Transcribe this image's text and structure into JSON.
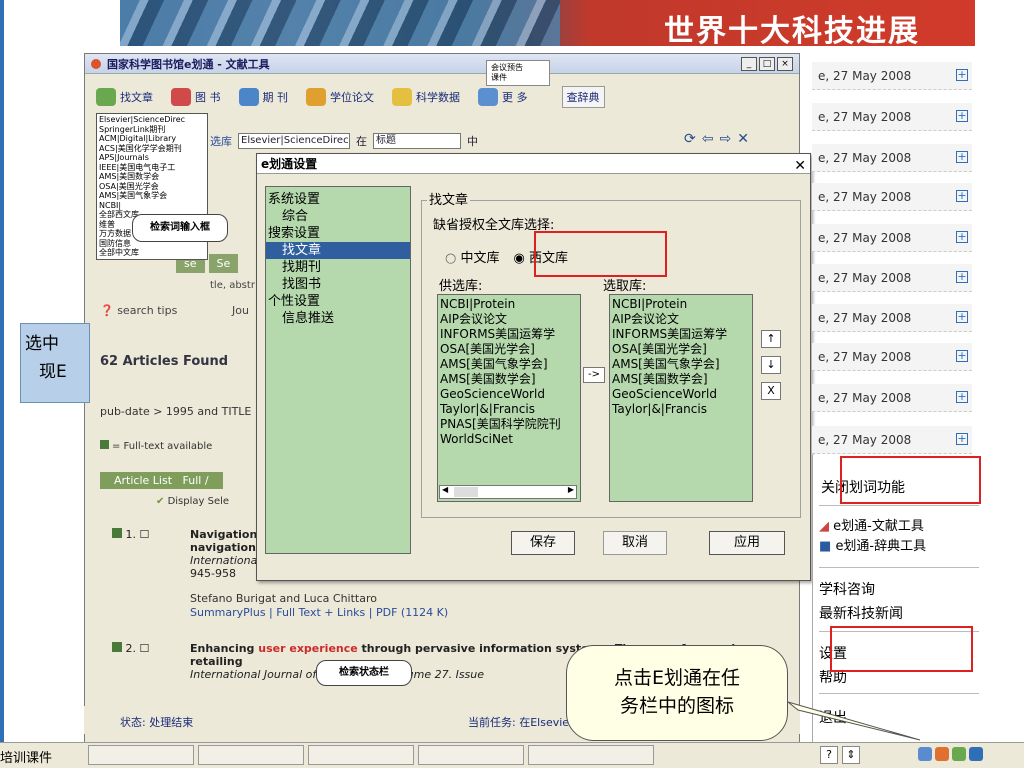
{
  "banner": {
    "title": "世界十大科技进展"
  },
  "main_window": {
    "title": "国家科学图书馆e划通 - 文献工具",
    "toolbar": [
      "找文章",
      "图 书",
      "期 刊",
      "学位论文",
      "科学数据",
      "更 多",
      "查辞典"
    ],
    "search_label": "选库",
    "db_select": "Elsevier|ScienceDirec",
    "in_label": "在",
    "field_select": "标题",
    "mid_label": "中",
    "more_popup": [
      "会议预告",
      "课件"
    ],
    "db_list": [
      "Elsevier|ScienceDirec",
      "SpringerLink期刊",
      "ACM|Digital|Library",
      "ACS|美国化学学会期刊",
      "APS|Journals",
      "IEEE|美国电气电子工",
      "AMS|美国数学会",
      "OSA|美国光学会",
      "AMS|美国气象学会",
      "NCBI|",
      "全部西文库",
      "维普",
      "万方数据",
      "国防信息",
      "全部中文库"
    ],
    "callout_search": "检索词输入框",
    "web": {
      "tabs": [
        "se",
        "Se"
      ],
      "abstr": "tle, abstr",
      "search_tips": "search tips",
      "jou": "Jou",
      "found": "62 Articles Found",
      "pubdate": "pub-date > 1995 and TITLE",
      "fulltext": "= Full-text available",
      "article_list": "Article List",
      "full": "Full /",
      "display_sel": "Display Sele",
      "art1_num": "1.",
      "art1_lines": [
        "Navigation",
        "navigation a",
        "Internationa",
        "945-958"
      ],
      "authors": "Stefano Burigat and Luca Chittaro",
      "links": "SummaryPlus | Full Text + Links | PDF (1124 K)",
      "art2_num": "2.",
      "art2_text_a": "Enhancing ",
      "art2_red": "user experience",
      "art2_text_b": " through pervasive information systems: The case of pervasive",
      "art2_line2": "retailing",
      "art2_line3": "International Journal of ... agement. Volume 27. Issue"
    },
    "status_left": "状态:  处理结束",
    "status_right": "当前任务:  在Elsevie",
    "callout_status": "检索状态栏"
  },
  "left_note": {
    "line1": "选中",
    "line2": "现E"
  },
  "dialog": {
    "title": "e划通设置",
    "tree": [
      "系统设置",
      "综合",
      "搜索设置",
      "找文章",
      "找期刊",
      "找图书",
      "个性设置",
      "信息推送"
    ],
    "group_title": "找文章",
    "default_label": "缺省授权全文库选择:",
    "radio_cn": "中文库",
    "radio_west": "西文库",
    "radio_selected": "西文库",
    "avail_label": "供选库:",
    "chosen_label": "选取库:",
    "avail_list": [
      "NCBI|Protein",
      "AIP会议论文",
      "INFORMS美国运筹学",
      "OSA[美国光学会]",
      "AMS[美国气象学会]",
      "AMS[美国数学会]",
      "GeoScienceWorld",
      "Taylor|&|Francis",
      "PNAS[美国科学院院刊",
      "WorldSciNet"
    ],
    "chosen_list": [
      "NCBI|Protein",
      "AIP会议论文",
      "INFORMS美国运筹学",
      "OSA[美国光学会]",
      "AMS[美国气象学会]",
      "AMS[美国数学会]",
      "GeoScienceWorld",
      "Taylor|&|Francis"
    ],
    "move_btn": "->",
    "up_btn": "↑",
    "down_btn": "↓",
    "remove_btn": "X",
    "save_btn": "保存",
    "cancel_btn": "取消",
    "apply_btn": "应用"
  },
  "right_dates": [
    "e, 27 May 2008",
    "e, 27 May 2008",
    "e, 27 May 2008",
    "e, 27 May 2008",
    "e, 27 May 2008",
    "e, 27 May 2008",
    "e, 27 May 2008",
    "e, 27 May 2008",
    "e, 27 May 2008",
    "e, 27 May 2008"
  ],
  "context_menu": {
    "close_word": "关闭划词功能",
    "tool1": "e划通-文献工具",
    "tool2": "e划通-辞典工具",
    "consult": "学科咨询",
    "news": "最新科技新闻",
    "settings": "设置",
    "help": "帮助",
    "exit": "退出"
  },
  "callout_main": {
    "line1": "点击E划通在任",
    "line2": "务栏中的图标"
  },
  "taskbar": {
    "left_label": "培训课件"
  },
  "colors": {
    "highlight_red": "#e02020",
    "tree_green": "#b5d9ad",
    "selected_blue": "#2f5f9f"
  }
}
